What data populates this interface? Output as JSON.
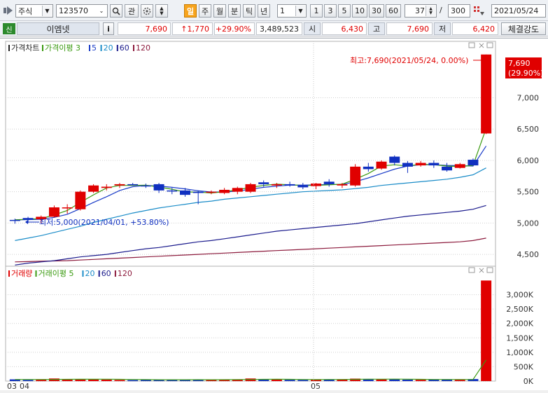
{
  "toolbar": {
    "market": "주식",
    "code": "123570",
    "gwan": "관",
    "periods": [
      "일",
      "주",
      "월",
      "분",
      "틱",
      "년"
    ],
    "active_period": "일",
    "period_unit": "1",
    "intervals": [
      "1",
      "3",
      "5",
      "10",
      "30",
      "60"
    ],
    "count": "37",
    "total": "300",
    "slash": "/",
    "date": "2021/05/24"
  },
  "quote": {
    "badge": "신",
    "name": "이엠넷",
    "info": "i",
    "price": "7,690",
    "change": "↑1,770",
    "change_pct": "+29.90%",
    "volume": "3,489,523",
    "open_label": "시",
    "open": "6,430",
    "high_label": "고",
    "high": "7,690",
    "low_label": "저",
    "low": "6,420",
    "strength": "체결강도"
  },
  "price_panel": {
    "legend": [
      {
        "label": "가격차트",
        "color": "#222222"
      },
      {
        "label": "가격이평 3",
        "color": "#3a9a10"
      },
      {
        "label": "5",
        "color": "#1a3cc8"
      },
      {
        "label": "20",
        "color": "#1a8cc8"
      },
      {
        "label": "60",
        "color": "#1a1a8c"
      },
      {
        "label": "120",
        "color": "#8c1a3c"
      }
    ],
    "max_annotation": "최고:7,690(2021/05/24, 0.00%)",
    "min_annotation": "최저:5,000(2021/04/01, +53.80%)",
    "current_tag_price": "7,690",
    "current_tag_pct": "(29.90%)",
    "ticks": [
      "7,000",
      "6,500",
      "6,000",
      "5,500",
      "5,000",
      "4,500"
    ]
  },
  "volume_panel": {
    "legend": [
      {
        "label": "거래량",
        "color": "#e00000"
      },
      {
        "label": "거래이평 5",
        "color": "#3a9a10"
      },
      {
        "label": "20",
        "color": "#1a8cc8"
      },
      {
        "label": "60",
        "color": "#1a1a8c"
      },
      {
        "label": "120",
        "color": "#8c1a3c"
      }
    ],
    "ticks": [
      "3,000K",
      "2,500K",
      "2,000K",
      "1,500K",
      "1,000K",
      "500K",
      "0K"
    ]
  },
  "x_labels": [
    "03",
    "04",
    "05"
  ],
  "colors": {
    "up": "#e00000",
    "down": "#1030c0",
    "ma3": "#3a9a10",
    "ma5": "#1a3cc8",
    "ma20": "#1a8cc8",
    "ma60": "#1a1a8c",
    "ma120": "#8c1a3c"
  },
  "chart_data": {
    "type": "candlestick",
    "price_range": [
      4300,
      7900
    ],
    "volume_range": [
      0,
      3500000
    ],
    "candles": [
      {
        "o": 5050,
        "h": 5070,
        "l": 4990,
        "c": 5040
      },
      {
        "o": 5080,
        "h": 5100,
        "l": 5000,
        "c": 5050
      },
      {
        "o": 5060,
        "h": 5120,
        "l": 5000,
        "c": 5100
      },
      {
        "o": 5100,
        "h": 5280,
        "l": 5090,
        "c": 5250
      },
      {
        "o": 5250,
        "h": 5300,
        "l": 5150,
        "c": 5250
      },
      {
        "o": 5220,
        "h": 5520,
        "l": 5200,
        "c": 5500
      },
      {
        "o": 5500,
        "h": 5620,
        "l": 5480,
        "c": 5600
      },
      {
        "o": 5560,
        "h": 5620,
        "l": 5520,
        "c": 5580
      },
      {
        "o": 5600,
        "h": 5640,
        "l": 5560,
        "c": 5620
      },
      {
        "o": 5620,
        "h": 5640,
        "l": 5600,
        "c": 5610
      },
      {
        "o": 5600,
        "h": 5630,
        "l": 5560,
        "c": 5590
      },
      {
        "o": 5620,
        "h": 5640,
        "l": 5480,
        "c": 5520
      },
      {
        "o": 5520,
        "h": 5560,
        "l": 5460,
        "c": 5510
      },
      {
        "o": 5520,
        "h": 5560,
        "l": 5420,
        "c": 5450
      },
      {
        "o": 5500,
        "h": 5520,
        "l": 5300,
        "c": 5480
      },
      {
        "o": 5490,
        "h": 5520,
        "l": 5460,
        "c": 5500
      },
      {
        "o": 5480,
        "h": 5560,
        "l": 5460,
        "c": 5530
      },
      {
        "o": 5500,
        "h": 5580,
        "l": 5460,
        "c": 5560
      },
      {
        "o": 5500,
        "h": 5640,
        "l": 5480,
        "c": 5620
      },
      {
        "o": 5650,
        "h": 5680,
        "l": 5580,
        "c": 5620
      },
      {
        "o": 5600,
        "h": 5640,
        "l": 5560,
        "c": 5620
      },
      {
        "o": 5620,
        "h": 5660,
        "l": 5580,
        "c": 5600
      },
      {
        "o": 5610,
        "h": 5640,
        "l": 5540,
        "c": 5570
      },
      {
        "o": 5590,
        "h": 5640,
        "l": 5540,
        "c": 5630
      },
      {
        "o": 5660,
        "h": 5700,
        "l": 5580,
        "c": 5620
      },
      {
        "o": 5600,
        "h": 5640,
        "l": 5560,
        "c": 5620
      },
      {
        "o": 5600,
        "h": 5940,
        "l": 5580,
        "c": 5900
      },
      {
        "o": 5900,
        "h": 5960,
        "l": 5820,
        "c": 5860
      },
      {
        "o": 5870,
        "h": 6000,
        "l": 5850,
        "c": 5980
      },
      {
        "o": 6060,
        "h": 6080,
        "l": 5920,
        "c": 5960
      },
      {
        "o": 5960,
        "h": 5990,
        "l": 5800,
        "c": 5900
      },
      {
        "o": 5920,
        "h": 5990,
        "l": 5900,
        "c": 5960
      },
      {
        "o": 5960,
        "h": 6000,
        "l": 5880,
        "c": 5920
      },
      {
        "o": 5900,
        "h": 5960,
        "l": 5820,
        "c": 5840
      },
      {
        "o": 5880,
        "h": 5960,
        "l": 5870,
        "c": 5940
      },
      {
        "o": 6010,
        "h": 6030,
        "l": 5920,
        "c": 5920
      },
      {
        "o": 6430,
        "h": 7690,
        "l": 6420,
        "c": 7690
      }
    ],
    "volumes": [
      60000,
      40000,
      45000,
      90000,
      55000,
      70000,
      60000,
      50000,
      40000,
      35000,
      40000,
      45000,
      50000,
      55000,
      45000,
      40000,
      50000,
      60000,
      90000,
      60000,
      50000,
      45000,
      40000,
      60000,
      55000,
      50000,
      85000,
      75000,
      60000,
      70000,
      50000,
      45000,
      60000,
      55000,
      45000,
      70000,
      3489523
    ],
    "ma3": [
      5050,
      5060,
      5070,
      5130,
      5200,
      5330,
      5450,
      5560,
      5600,
      5600,
      5605,
      5575,
      5540,
      5495,
      5495,
      5480,
      5500,
      5530,
      5570,
      5600,
      5620,
      5610,
      5600,
      5600,
      5610,
      5620,
      5700,
      5790,
      5910,
      5930,
      5910,
      5940,
      5930,
      5910,
      5900,
      5920,
      6510
    ],
    "ma5": [
      5050,
      5055,
      5060,
      5090,
      5140,
      5230,
      5330,
      5420,
      5520,
      5580,
      5600,
      5590,
      5570,
      5545,
      5515,
      5495,
      5495,
      5510,
      5540,
      5570,
      5590,
      5605,
      5605,
      5610,
      5615,
      5615,
      5660,
      5720,
      5790,
      5860,
      5910,
      5930,
      5930,
      5920,
      5915,
      5910,
      6230
    ],
    "ma20": [
      4720,
      4760,
      4800,
      4850,
      4900,
      4950,
      5010,
      5060,
      5110,
      5160,
      5200,
      5240,
      5270,
      5300,
      5330,
      5350,
      5380,
      5400,
      5420,
      5440,
      5460,
      5480,
      5500,
      5510,
      5520,
      5530,
      5550,
      5570,
      5600,
      5620,
      5640,
      5660,
      5680,
      5700,
      5730,
      5770,
      5880
    ],
    "ma60": [
      4330,
      4360,
      4380,
      4400,
      4430,
      4460,
      4480,
      4500,
      4530,
      4560,
      4590,
      4610,
      4640,
      4670,
      4700,
      4720,
      4750,
      4780,
      4810,
      4840,
      4870,
      4890,
      4910,
      4930,
      4950,
      4970,
      4990,
      5020,
      5050,
      5080,
      5110,
      5130,
      5150,
      5170,
      5190,
      5220,
      5280
    ],
    "ma120": [
      4380,
      4385,
      4390,
      4395,
      4400,
      4410,
      4420,
      4430,
      4440,
      4450,
      4460,
      4470,
      4480,
      4490,
      4500,
      4510,
      4520,
      4530,
      4540,
      4550,
      4560,
      4570,
      4580,
      4590,
      4600,
      4610,
      4620,
      4630,
      4640,
      4650,
      4660,
      4670,
      4680,
      4690,
      4700,
      4720,
      4760
    ],
    "vma5": [
      55000,
      55000,
      55000,
      58000,
      60000,
      62000,
      64000,
      65000,
      60000,
      55000,
      50000,
      45000,
      45000,
      47000,
      48000,
      47000,
      48000,
      50000,
      57000,
      60000,
      62000,
      60000,
      55000,
      52000,
      55000,
      55000,
      60000,
      65000,
      65000,
      68000,
      66000,
      60000,
      55000,
      57000,
      55000,
      55000,
      735000
    ]
  }
}
